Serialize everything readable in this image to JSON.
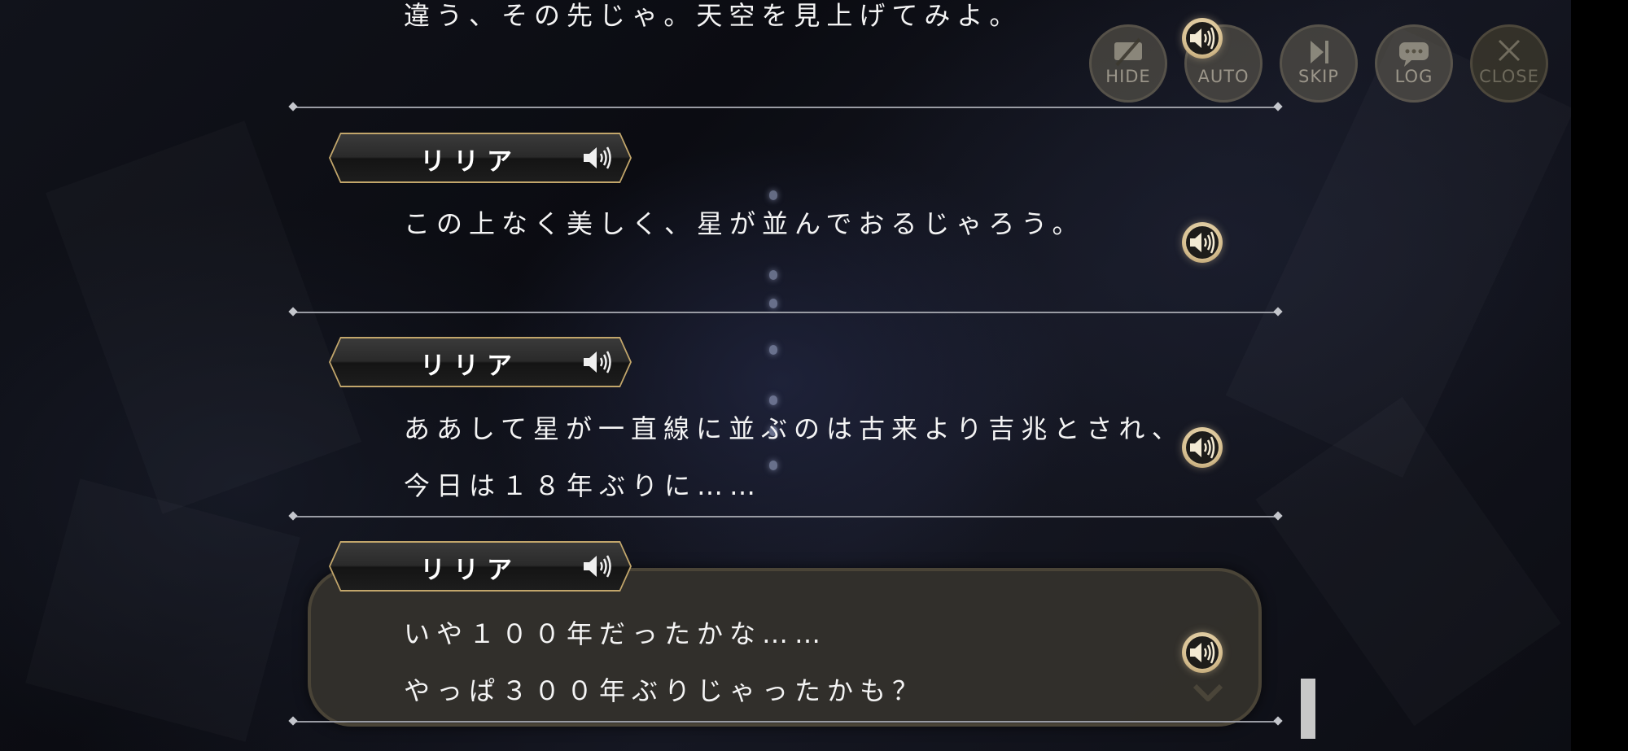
{
  "toolbar": {
    "hide_label": "HIDE",
    "auto_label": "AUTO",
    "skip_label": "SKIP",
    "log_label": "LOG",
    "close_label": "CLOSE"
  },
  "log": {
    "entries": [
      {
        "lines": [
          "違う、その先じゃ。天空を見上げてみよ。"
        ]
      },
      {
        "speaker": "リリア",
        "lines": [
          "この上なく美しく、星が並んでおるじゃろう。"
        ]
      },
      {
        "speaker": "リリア",
        "lines": [
          "ああして星が一直線に並ぶのは古来より吉兆とされ、",
          "今日は１８年ぶりに……"
        ]
      },
      {
        "speaker": "リリア",
        "lines": [
          "いや１００年だったかな……",
          "やっぱ３００年ぶりじゃったかも？"
        ],
        "current": true
      }
    ]
  },
  "colors": {
    "accent_gold": "#c2a66b",
    "panel": "#34322c"
  },
  "icons": {
    "voice": "speaker-icon",
    "hide": "hide-eye-icon",
    "skip": "skip-forward-icon",
    "log": "chat-bubble-icon",
    "close": "close-icon",
    "more": "chevron-down-icon"
  }
}
